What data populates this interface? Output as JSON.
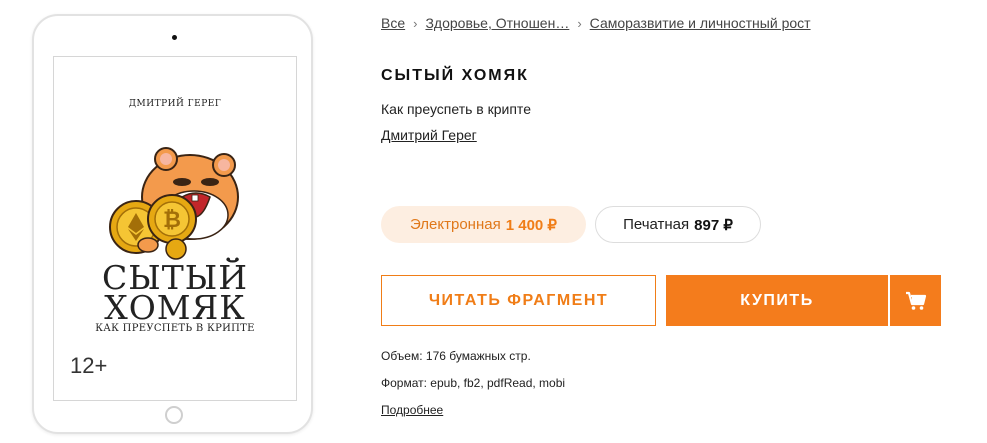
{
  "cover": {
    "author": "ДМИТРИЙ ГЕРЕГ",
    "title_line1": "СЫТЫЙ",
    "title_line2": "ХОМЯК",
    "subtitle": "КАК ПРЕУСПЕТЬ В КРИПТЕ",
    "age_rating": "12+"
  },
  "breadcrumb": {
    "items": [
      "Все",
      "Здоровье, Отношен…",
      "Саморазвитие и личностный рост"
    ],
    "separator": "›"
  },
  "book": {
    "title": "СЫТЫЙ ХОМЯК",
    "subtitle": "Как преуспеть в крипте",
    "author": "Дмитрий Герег"
  },
  "formats": {
    "ebook": {
      "label": "Электронная",
      "price": "1 400 ₽"
    },
    "print": {
      "label": "Печатная",
      "price": "897 ₽"
    }
  },
  "actions": {
    "read_fragment": "ЧИТАТЬ ФРАГМЕНТ",
    "buy": "КУПИТЬ",
    "cart_icon": "cart-icon"
  },
  "details": {
    "volume": "Объем: 176 бумажных стр.",
    "format": "Формат: epub, fb2, pdfRead, mobi",
    "more": "Подробнее"
  },
  "colors": {
    "accent": "#f47c1c",
    "accent_light": "#fdeee1"
  }
}
